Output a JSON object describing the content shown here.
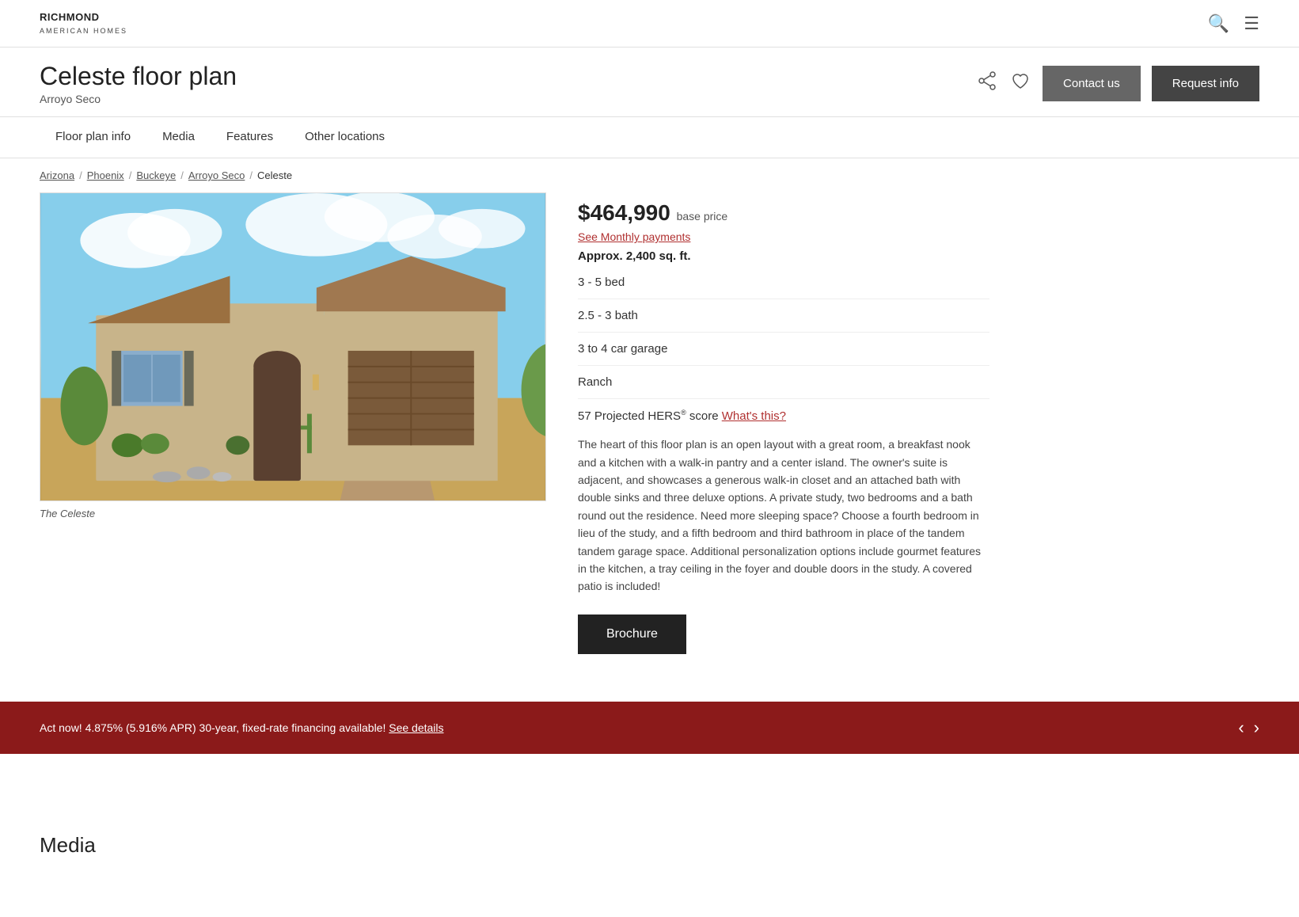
{
  "header": {
    "logo_line1": "RICHMOND",
    "logo_line2": "AMERICAN HOMES"
  },
  "title_bar": {
    "floor_plan_name": "Celeste floor plan",
    "community_name": "Arroyo Seco",
    "contact_label": "Contact us",
    "request_label": "Request info"
  },
  "nav": {
    "tabs": [
      {
        "label": "Floor plan info",
        "id": "floor-plan-info"
      },
      {
        "label": "Media",
        "id": "media"
      },
      {
        "label": "Features",
        "id": "features"
      },
      {
        "label": "Other locations",
        "id": "other-locations"
      }
    ]
  },
  "breadcrumb": {
    "items": [
      {
        "label": "Arizona",
        "link": true
      },
      {
        "label": "Phoenix",
        "link": true
      },
      {
        "label": "Buckeye",
        "link": true
      },
      {
        "label": "Arroyo Seco",
        "link": true
      },
      {
        "label": "Celeste",
        "link": false
      }
    ]
  },
  "property": {
    "image_caption": "The Celeste",
    "price": "$464,990",
    "price_label": "base price",
    "monthly_link": "See Monthly payments",
    "sqft": "Approx. 2,400 sq. ft.",
    "bed": "3 - 5 bed",
    "bath": "2.5 - 3 bath",
    "garage": "3 to 4 car garage",
    "style": "Ranch",
    "hers_score": "57 Projected HERS",
    "hers_reg": "®",
    "hers_score_suffix": " score ",
    "hers_link": "What's this?",
    "description": "The heart of this floor plan is an open layout with a great room, a breakfast nook and a kitchen with a walk-in pantry and a center island. The owner's suite is adjacent, and showcases a generous walk-in closet and an attached bath with double sinks and three deluxe options. A private study, two bedrooms and a bath round out the residence. Need more sleeping space? Choose a fourth bedroom in lieu of the study, and a fifth bedroom and third bathroom in place of the tandem tandem garage space. Additional personalization options include gourmet features in the kitchen, a tray ceiling in the foyer and double doors in the study. A covered patio is included!",
    "brochure_label": "Brochure"
  },
  "financing": {
    "text": "Act now! 4.875% (5.916% APR) 30-year, fixed-rate financing available!",
    "link_label": "See details"
  },
  "media_section": {
    "heading": "Media"
  }
}
